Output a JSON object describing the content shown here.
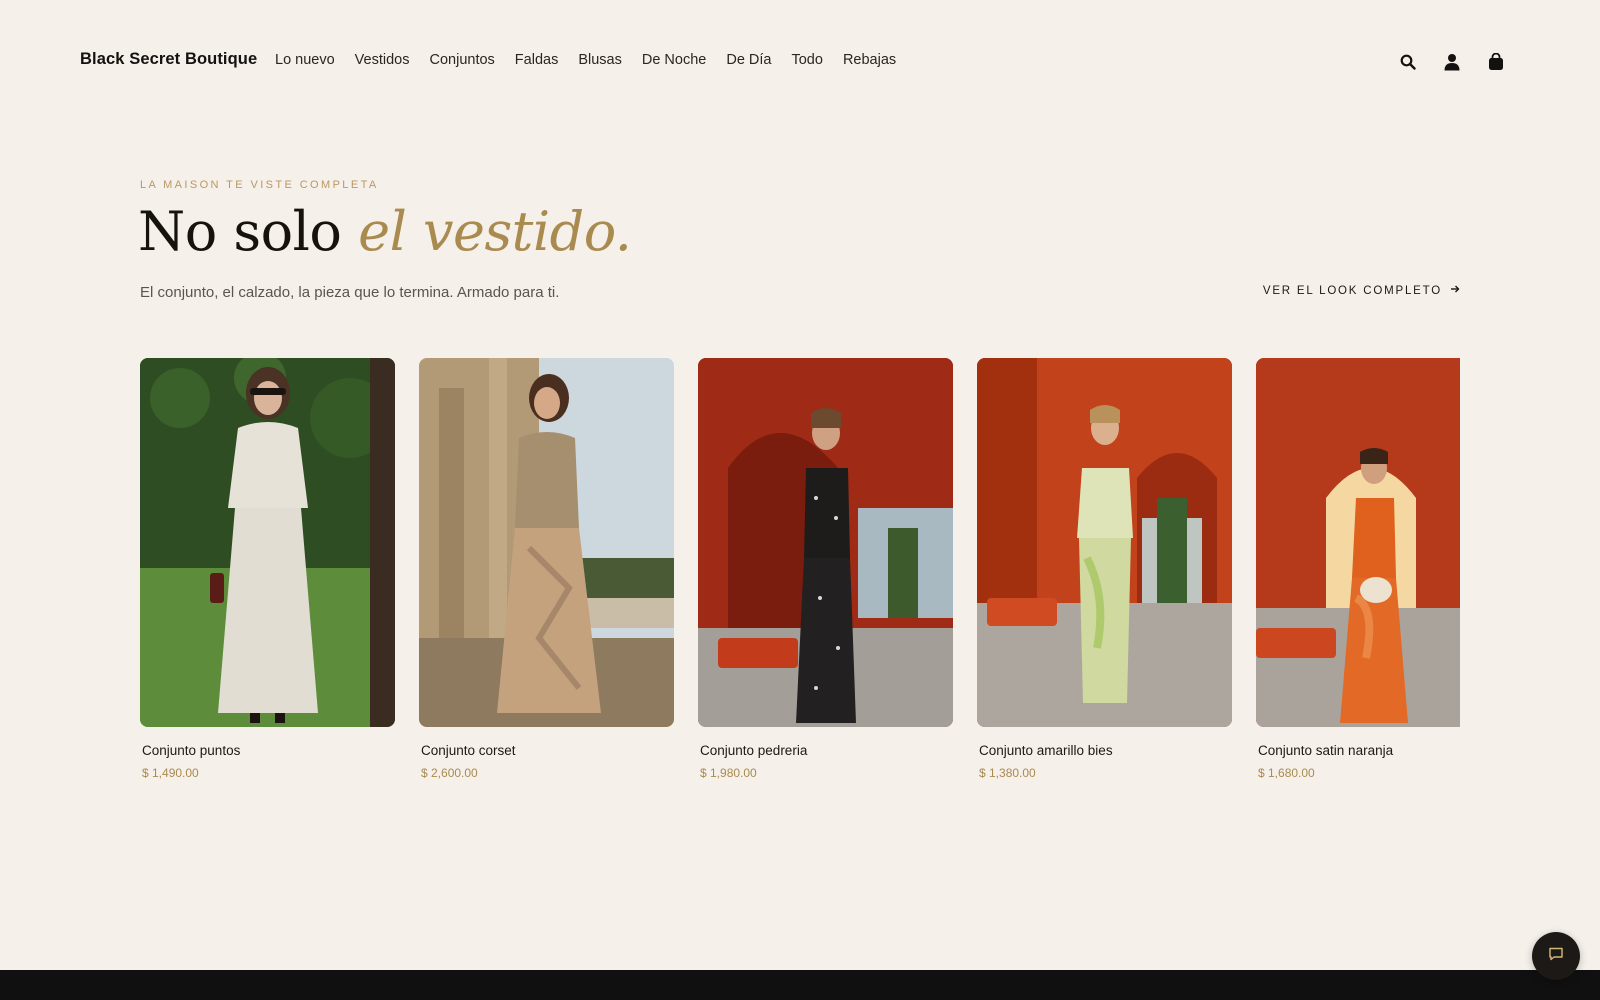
{
  "header": {
    "brand": "Black Secret Boutique",
    "nav": [
      "Lo nuevo",
      "Vestidos",
      "Conjuntos",
      "Faldas",
      "Blusas",
      "De Noche",
      "De Día",
      "Todo",
      "Rebajas"
    ],
    "icons": [
      "search-icon",
      "account-icon",
      "cart-icon"
    ]
  },
  "hero": {
    "eyebrow": "LA MAISON TE VISTE COMPLETA",
    "headline_plain": "No solo",
    "headline_accent": "el vestido.",
    "subline": "El conjunto, el calzado, la pieza que lo termina. Armado para ti.",
    "cta_label": "VER EL LOOK COMPLETO",
    "cta_icon": "arrow-right-icon"
  },
  "products": [
    {
      "name": "Conjunto puntos",
      "price": "$ 1,490.00"
    },
    {
      "name": "Conjunto corset",
      "price": "$ 2,600.00"
    },
    {
      "name": "Conjunto pedreria",
      "price": "$ 1,980.00"
    },
    {
      "name": "Conjunto amarillo bies",
      "price": "$ 1,380.00"
    },
    {
      "name": "Conjunto satin naranja",
      "price": "$ 1,680.00"
    }
  ],
  "chat": {
    "icon": "chat-icon"
  },
  "colors": {
    "background": "#f6f0ea",
    "accent_gold": "#a98a4f",
    "text_dark": "#1c1917",
    "footer": "#111010"
  }
}
